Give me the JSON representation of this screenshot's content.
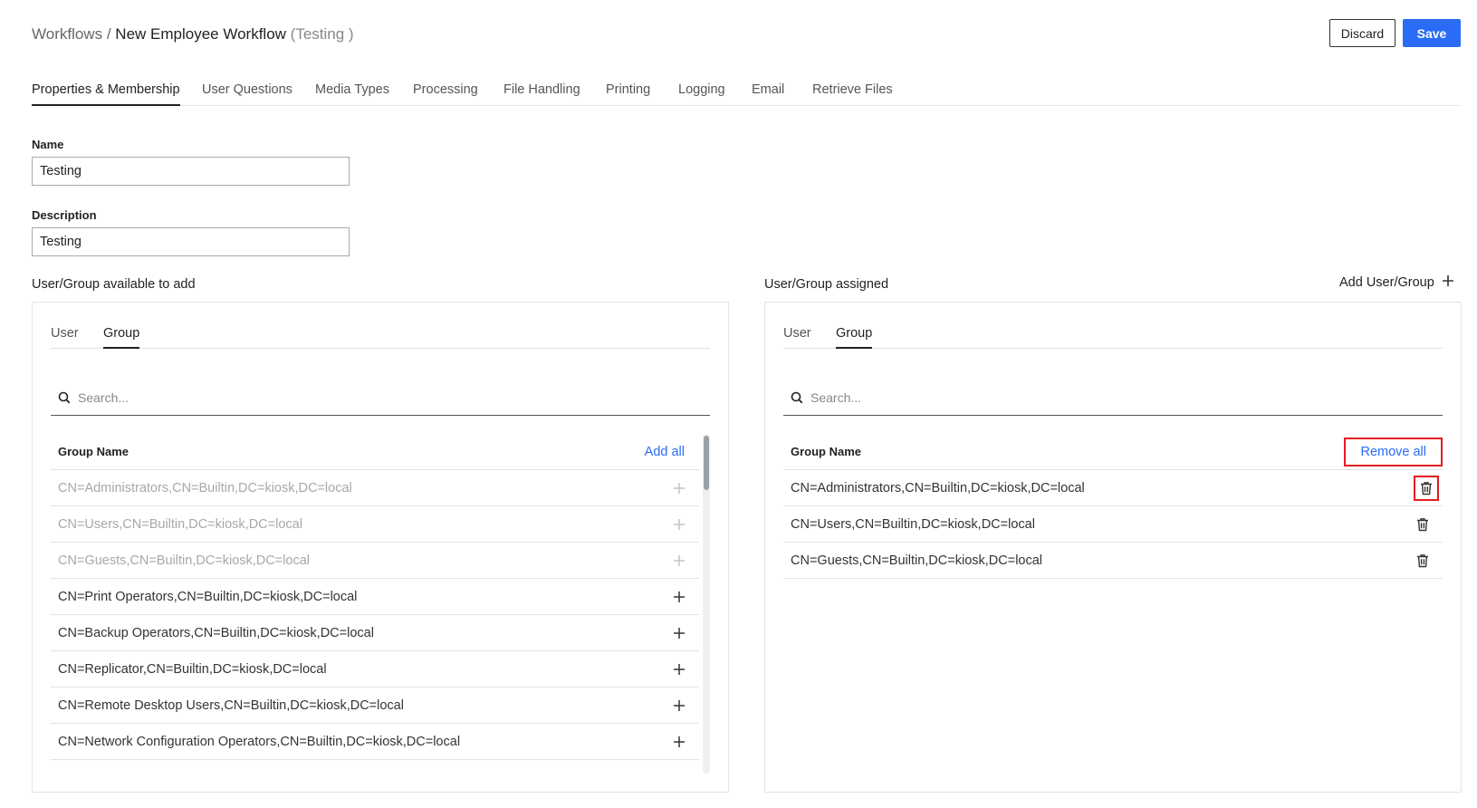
{
  "breadcrumb": {
    "root": "Workflows",
    "separator": "/",
    "current": "New Employee Workflow",
    "status": "(Testing )"
  },
  "actions": {
    "discard": "Discard",
    "save": "Save"
  },
  "colors": {
    "accent": "#2a6cf6",
    "highlight": "#e31b23"
  },
  "tabs": [
    {
      "label": "Properties & Membership",
      "active": true
    },
    {
      "label": "User Questions"
    },
    {
      "label": "Media Types"
    },
    {
      "label": "Processing"
    },
    {
      "label": "File Handling"
    },
    {
      "label": "Printing"
    },
    {
      "label": "Logging"
    },
    {
      "label": "Email"
    },
    {
      "label": "Retrieve Files"
    }
  ],
  "form": {
    "name_label": "Name",
    "name_value": "Testing",
    "description_label": "Description",
    "description_value": "Testing"
  },
  "available": {
    "label": "User/Group available to add",
    "sub_tabs": {
      "user": "User",
      "group": "Group",
      "active": "group"
    },
    "search_placeholder": "Search...",
    "column": "Group Name",
    "action": "Add all",
    "row_icon": "plus-icon",
    "rows": [
      {
        "name": "CN=Administrators,CN=Builtin,DC=kiosk,DC=local",
        "disabled": true
      },
      {
        "name": "CN=Users,CN=Builtin,DC=kiosk,DC=local",
        "disabled": true
      },
      {
        "name": "CN=Guests,CN=Builtin,DC=kiosk,DC=local",
        "disabled": true
      },
      {
        "name": "CN=Print Operators,CN=Builtin,DC=kiosk,DC=local",
        "disabled": false
      },
      {
        "name": "CN=Backup Operators,CN=Builtin,DC=kiosk,DC=local",
        "disabled": false
      },
      {
        "name": "CN=Replicator,CN=Builtin,DC=kiosk,DC=local",
        "disabled": false
      },
      {
        "name": "CN=Remote Desktop Users,CN=Builtin,DC=kiosk,DC=local",
        "disabled": false
      },
      {
        "name": "CN=Network Configuration Operators,CN=Builtin,DC=kiosk,DC=local",
        "disabled": false
      }
    ]
  },
  "assigned": {
    "label": "User/Group assigned",
    "add_label": "Add User/Group",
    "sub_tabs": {
      "user": "User",
      "group": "Group",
      "active": "group"
    },
    "search_placeholder": "Search...",
    "column": "Group Name",
    "action": "Remove all",
    "row_icon": "trash-icon",
    "rows": [
      {
        "name": "CN=Administrators,CN=Builtin,DC=kiosk,DC=local",
        "highlighted": true
      },
      {
        "name": "CN=Users,CN=Builtin,DC=kiosk,DC=local"
      },
      {
        "name": "CN=Guests,CN=Builtin,DC=kiosk,DC=local"
      }
    ]
  }
}
